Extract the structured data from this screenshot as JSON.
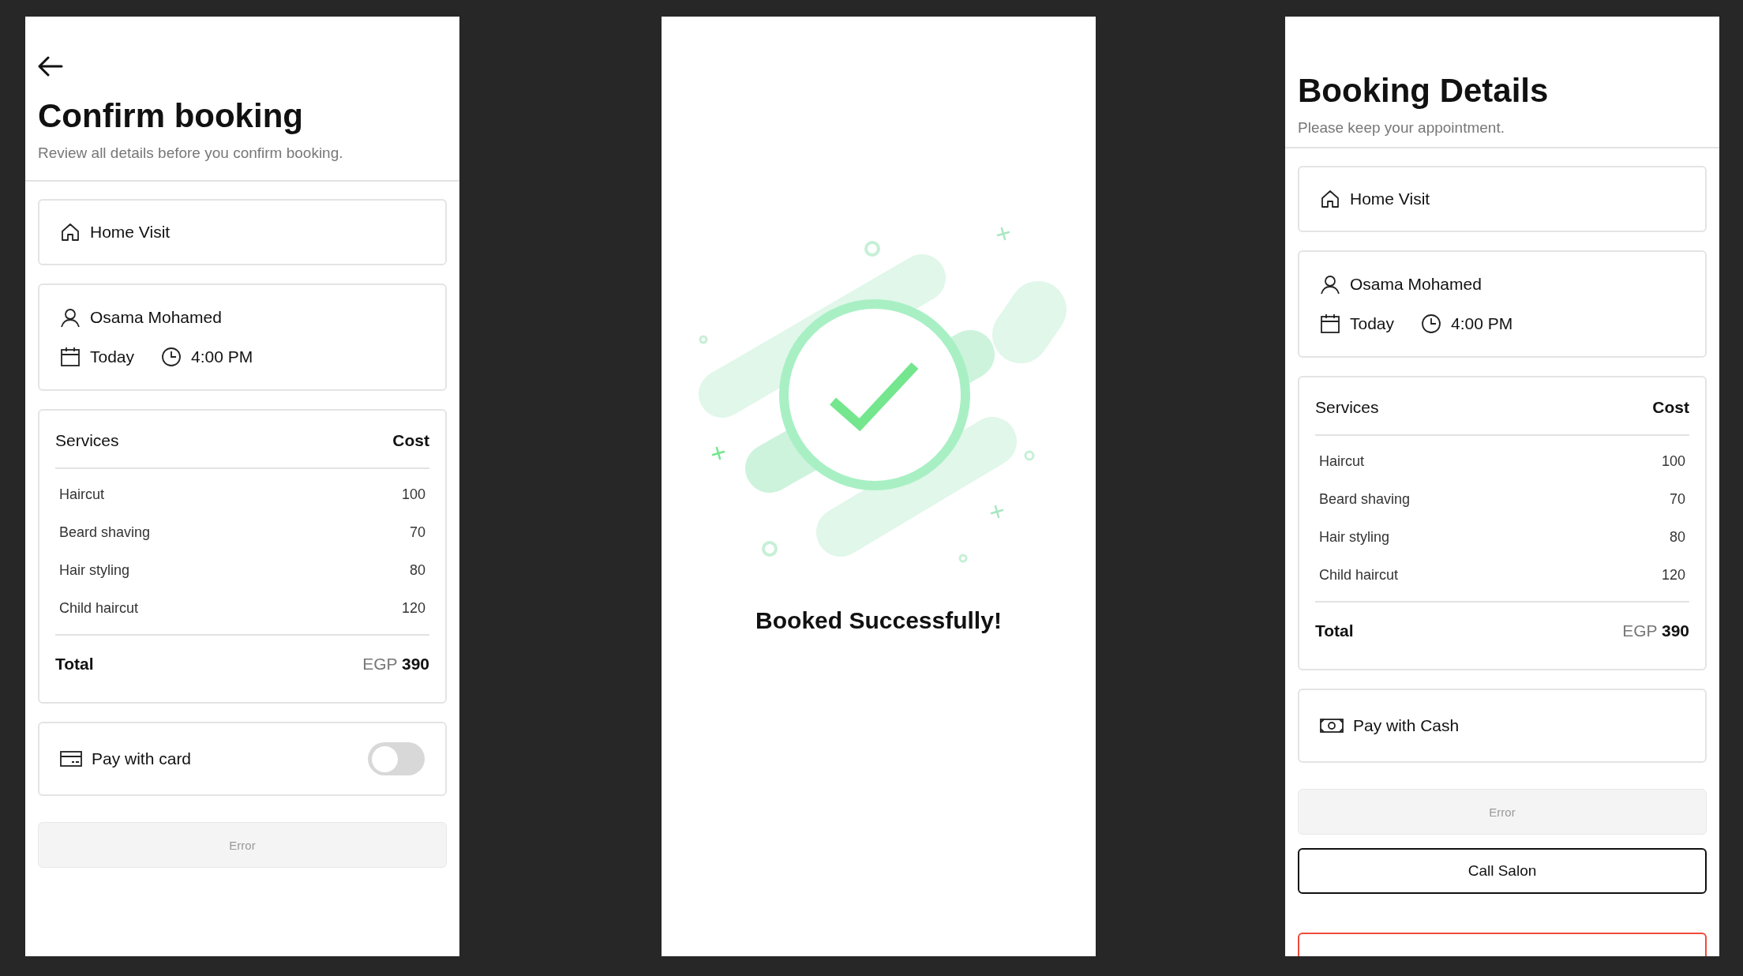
{
  "confirm_screen": {
    "has_back": true,
    "title": "Confirm booking",
    "subtitle": "Review all details before you confirm booking.",
    "cards": [
      {
        "kind": "visit",
        "label": "Home Visit"
      },
      {
        "kind": "appointment",
        "name": "Osama Mohamed",
        "date": "Today",
        "time": "4:00 PM"
      },
      {
        "kind": "services",
        "service_heading": "Services",
        "cost_heading": "Cost",
        "items": [
          {
            "name": "Haircut",
            "cost": "100"
          },
          {
            "name": "Beard shaving",
            "cost": "70"
          },
          {
            "name": "Hair styling",
            "cost": "80"
          },
          {
            "name": "Child haircut",
            "cost": "120"
          }
        ],
        "total_label": "Total",
        "total_value": "EGP **390**"
      },
      {
        "kind": "card_payment",
        "label": "Pay with card",
        "on": false
      }
    ],
    "buttons": [
      {
        "kind": "disabled",
        "label": "Error"
      }
    ]
  },
  "success_screen": {
    "message": "Booked Successfully!"
  },
  "details_screen": {
    "title": "Booking Details",
    "subtitle": "Please keep your appointment.",
    "cards": [
      {
        "kind": "visit",
        "label": "Home Visit"
      },
      {
        "kind": "appointment",
        "name": "Osama Mohamed",
        "date": "Today",
        "time": "4:00 PM"
      },
      {
        "kind": "services",
        "service_heading": "Services",
        "cost_heading": "Cost",
        "items": [
          {
            "name": "Haircut",
            "cost": "100"
          },
          {
            "name": "Beard shaving",
            "cost": "70"
          },
          {
            "name": "Hair styling",
            "cost": "80"
          },
          {
            "name": "Child haircut",
            "cost": "120"
          }
        ],
        "total_label": "Total",
        "total_value": "EGP **390**"
      },
      {
        "kind": "cash_payment",
        "label": "Pay with Cash"
      }
    ],
    "buttons": [
      {
        "kind": "disabled",
        "label": "Error"
      },
      {
        "kind": "outline",
        "label": "Call Salon"
      },
      {
        "kind": "danger_cut"
      }
    ]
  }
}
